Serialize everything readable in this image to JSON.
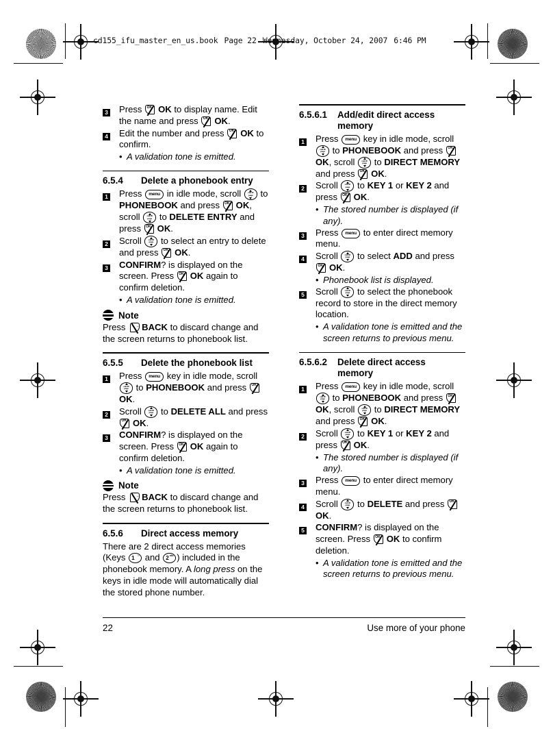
{
  "document": {
    "header_file": "cd155_ifu_master_en_us.book",
    "header_page": "Page 22",
    "header_day": "Wednesday, October 24, 2007",
    "header_time": "6:46 PM"
  },
  "icons": {
    "ok_key": "ok-softkey-icon",
    "back_key": "back-softkey-icon",
    "menu_key": "menu-key-icon",
    "scroll_key": "scroll-navigation-key-icon",
    "note": "note-icon",
    "key1": "keypad-1-icon",
    "key2": "keypad-2-icon"
  },
  "labels": {
    "ok": "OK",
    "back": "BACK",
    "menu": "menu",
    "scroll_mid_top": "call ID",
    "scroll_mid_bottom": "page",
    "key1_digit": "1",
    "key1_sub": "∞",
    "key2_digit": "2",
    "key2_sub": "abc",
    "note": "Note",
    "bullet_dot": "•"
  },
  "left_column": {
    "continued_steps": [
      {
        "num": "3",
        "parts": [
          {
            "t": "text",
            "v": "Press "
          },
          {
            "t": "key",
            "v": "ok"
          },
          {
            "t": "bold",
            "v": "OK"
          },
          {
            "t": "text",
            "v": " to display name. Edit the name and press "
          },
          {
            "t": "key",
            "v": "ok"
          },
          {
            "t": "bold",
            "v": "OK"
          },
          {
            "t": "text",
            "v": "."
          }
        ]
      },
      {
        "num": "4",
        "parts": [
          {
            "t": "text",
            "v": "Edit the number and press "
          },
          {
            "t": "key",
            "v": "ok"
          },
          {
            "t": "bold",
            "v": "OK"
          },
          {
            "t": "text",
            "v": " to confirm."
          }
        ],
        "bullets": [
          "A validation tone is emitted."
        ]
      }
    ],
    "sections": [
      {
        "num": "6.5.4",
        "title": "Delete a phonebook entry",
        "steps": [
          {
            "num": "1",
            "parts": [
              {
                "t": "text",
                "v": "Press "
              },
              {
                "t": "key",
                "v": "menu"
              },
              {
                "t": "text",
                "v": " in idle mode, scroll "
              },
              {
                "t": "key",
                "v": "scroll"
              },
              {
                "t": "text",
                "v": " to "
              },
              {
                "t": "bold",
                "v": "PHONEBOOK"
              },
              {
                "t": "text",
                "v": " and press "
              },
              {
                "t": "key",
                "v": "ok"
              },
              {
                "t": "bold",
                "v": "OK"
              },
              {
                "t": "text",
                "v": ", scroll "
              },
              {
                "t": "key",
                "v": "scroll"
              },
              {
                "t": "text",
                "v": " to "
              },
              {
                "t": "bold",
                "v": "DELETE ENTRY"
              },
              {
                "t": "text",
                "v": " and press "
              },
              {
                "t": "key",
                "v": "ok"
              },
              {
                "t": "bold",
                "v": "OK"
              },
              {
                "t": "text",
                "v": "."
              }
            ]
          },
          {
            "num": "2",
            "parts": [
              {
                "t": "text",
                "v": "Scroll "
              },
              {
                "t": "key",
                "v": "scroll"
              },
              {
                "t": "text",
                "v": " to select an entry to delete and press "
              },
              {
                "t": "key",
                "v": "ok"
              },
              {
                "t": "bold",
                "v": "OK"
              },
              {
                "t": "text",
                "v": "."
              }
            ]
          },
          {
            "num": "3",
            "parts": [
              {
                "t": "bold",
                "v": "CONFIRM"
              },
              {
                "t": "text",
                "v": "? is displayed on the screen. Press "
              },
              {
                "t": "key",
                "v": "ok"
              },
              {
                "t": "bold",
                "v": "OK"
              },
              {
                "t": "text",
                "v": " again to confirm deletion."
              }
            ],
            "bullets": [
              "A validation tone is emitted."
            ]
          }
        ],
        "note": {
          "title": "Note",
          "parts": [
            {
              "t": "text",
              "v": "Press "
            },
            {
              "t": "key",
              "v": "back"
            },
            {
              "t": "bold",
              "v": "BACK"
            },
            {
              "t": "text",
              "v": " to discard change and the screen returns to phonebook list."
            }
          ]
        }
      },
      {
        "num": "6.5.5",
        "title": "Delete the phonebook list",
        "steps": [
          {
            "num": "1",
            "parts": [
              {
                "t": "text",
                "v": "Press "
              },
              {
                "t": "key",
                "v": "menu"
              },
              {
                "t": "text",
                "v": " key in idle mode, scroll "
              },
              {
                "t": "key",
                "v": "scroll"
              },
              {
                "t": "text",
                "v": " to "
              },
              {
                "t": "bold",
                "v": "PHONEBOOK"
              },
              {
                "t": "text",
                "v": " and press "
              },
              {
                "t": "key",
                "v": "ok"
              },
              {
                "t": "bold",
                "v": "OK"
              },
              {
                "t": "text",
                "v": "."
              }
            ]
          },
          {
            "num": "2",
            "parts": [
              {
                "t": "text",
                "v": "Scroll "
              },
              {
                "t": "key",
                "v": "scroll"
              },
              {
                "t": "text",
                "v": " to "
              },
              {
                "t": "bold",
                "v": "DELETE ALL"
              },
              {
                "t": "text",
                "v": " and press "
              },
              {
                "t": "key",
                "v": "ok"
              },
              {
                "t": "bold",
                "v": "OK"
              },
              {
                "t": "text",
                "v": "."
              }
            ]
          },
          {
            "num": "3",
            "parts": [
              {
                "t": "bold",
                "v": "CONFIRM"
              },
              {
                "t": "text",
                "v": "? is displayed on the screen. Press "
              },
              {
                "t": "key",
                "v": "ok"
              },
              {
                "t": "bold",
                "v": "OK"
              },
              {
                "t": "text",
                "v": " again to confirm deletion."
              }
            ],
            "bullets": [
              "A validation tone is emitted."
            ]
          }
        ],
        "note": {
          "title": "Note",
          "parts": [
            {
              "t": "text",
              "v": "Press "
            },
            {
              "t": "key",
              "v": "back"
            },
            {
              "t": "bold",
              "v": "BACK"
            },
            {
              "t": "text",
              "v": " to discard change and the screen returns to phonebook list."
            }
          ]
        }
      },
      {
        "num": "6.5.6",
        "title": "Direct access memory",
        "paragraph": [
          {
            "t": "text",
            "v": "There are 2 direct access memories (Keys "
          },
          {
            "t": "key",
            "v": "key1"
          },
          {
            "t": "text",
            "v": " and "
          },
          {
            "t": "key",
            "v": "key2"
          },
          {
            "t": "text",
            "v": ") included in the phonebook memory. A "
          },
          {
            "t": "ital",
            "v": "long press"
          },
          {
            "t": "text",
            "v": " on the keys in idle mode will automatically dial the stored phone number."
          }
        ]
      }
    ]
  },
  "right_column": {
    "sections": [
      {
        "num": "6.5.6.1",
        "title_line1": "Add/edit direct access",
        "title_line2": "memory",
        "steps": [
          {
            "num": "1",
            "parts": [
              {
                "t": "text",
                "v": "Press "
              },
              {
                "t": "key",
                "v": "menu"
              },
              {
                "t": "text",
                "v": " key in idle mode, scroll "
              },
              {
                "t": "key",
                "v": "scroll"
              },
              {
                "t": "text",
                "v": " to "
              },
              {
                "t": "bold",
                "v": "PHONEBOOK"
              },
              {
                "t": "text",
                "v": " and press "
              },
              {
                "t": "key",
                "v": "ok"
              },
              {
                "t": "bold",
                "v": "OK"
              },
              {
                "t": "text",
                "v": ", scroll "
              },
              {
                "t": "key",
                "v": "scroll"
              },
              {
                "t": "text",
                "v": " to "
              },
              {
                "t": "bold",
                "v": "DIRECT MEMORY"
              },
              {
                "t": "text",
                "v": " and press "
              },
              {
                "t": "key",
                "v": "ok"
              },
              {
                "t": "bold",
                "v": "OK"
              },
              {
                "t": "text",
                "v": "."
              }
            ]
          },
          {
            "num": "2",
            "parts": [
              {
                "t": "text",
                "v": "Scroll "
              },
              {
                "t": "key",
                "v": "scroll"
              },
              {
                "t": "text",
                "v": " to "
              },
              {
                "t": "bold",
                "v": "KEY 1"
              },
              {
                "t": "text",
                "v": " or "
              },
              {
                "t": "bold",
                "v": "KEY 2"
              },
              {
                "t": "text",
                "v": " and press "
              },
              {
                "t": "key",
                "v": "ok"
              },
              {
                "t": "bold",
                "v": "OK"
              },
              {
                "t": "text",
                "v": "."
              }
            ],
            "bullets": [
              "The stored number is displayed (if any)."
            ]
          },
          {
            "num": "3",
            "parts": [
              {
                "t": "text",
                "v": "Press "
              },
              {
                "t": "key",
                "v": "menu"
              },
              {
                "t": "text",
                "v": " to enter direct memory menu."
              }
            ]
          },
          {
            "num": "4",
            "parts": [
              {
                "t": "text",
                "v": "Scroll "
              },
              {
                "t": "key",
                "v": "scroll"
              },
              {
                "t": "text",
                "v": " to select "
              },
              {
                "t": "bold",
                "v": "ADD"
              },
              {
                "t": "text",
                "v": " and press "
              },
              {
                "t": "key",
                "v": "ok"
              },
              {
                "t": "bold",
                "v": "OK"
              },
              {
                "t": "text",
                "v": "."
              }
            ],
            "bullets": [
              "Phonebook list is displayed."
            ]
          },
          {
            "num": "5",
            "parts": [
              {
                "t": "text",
                "v": "Scroll "
              },
              {
                "t": "key",
                "v": "scroll"
              },
              {
                "t": "text",
                "v": " to select the phonebook record to store in the direct memory location."
              }
            ],
            "bullets": [
              "A validation tone is emitted and the screen returns to previous menu."
            ]
          }
        ]
      },
      {
        "num": "6.5.6.2",
        "title_line1": "Delete direct access",
        "title_line2": "memory",
        "steps": [
          {
            "num": "1",
            "parts": [
              {
                "t": "text",
                "v": "Press "
              },
              {
                "t": "key",
                "v": "menu"
              },
              {
                "t": "text",
                "v": " key in idle mode, scroll "
              },
              {
                "t": "key",
                "v": "scroll"
              },
              {
                "t": "text",
                "v": " to "
              },
              {
                "t": "bold",
                "v": "PHONEBOOK"
              },
              {
                "t": "text",
                "v": " and press "
              },
              {
                "t": "key",
                "v": "ok"
              },
              {
                "t": "bold",
                "v": "OK"
              },
              {
                "t": "text",
                "v": ", scroll "
              },
              {
                "t": "key",
                "v": "scroll"
              },
              {
                "t": "text",
                "v": " to "
              },
              {
                "t": "bold",
                "v": "DIRECT MEMORY"
              },
              {
                "t": "text",
                "v": " and press "
              },
              {
                "t": "key",
                "v": "ok"
              },
              {
                "t": "bold",
                "v": "OK"
              },
              {
                "t": "text",
                "v": "."
              }
            ]
          },
          {
            "num": "2",
            "parts": [
              {
                "t": "text",
                "v": "Scroll "
              },
              {
                "t": "key",
                "v": "scroll"
              },
              {
                "t": "text",
                "v": " to "
              },
              {
                "t": "bold",
                "v": "KEY 1"
              },
              {
                "t": "text",
                "v": " or "
              },
              {
                "t": "bold",
                "v": "KEY 2"
              },
              {
                "t": "text",
                "v": " and press "
              },
              {
                "t": "key",
                "v": "ok"
              },
              {
                "t": "bold",
                "v": "OK"
              },
              {
                "t": "text",
                "v": "."
              }
            ],
            "bullets": [
              "The stored number is displayed (if any)."
            ]
          },
          {
            "num": "3",
            "parts": [
              {
                "t": "text",
                "v": "Press "
              },
              {
                "t": "key",
                "v": "menu"
              },
              {
                "t": "text",
                "v": " to enter direct memory menu."
              }
            ]
          },
          {
            "num": "4",
            "parts": [
              {
                "t": "text",
                "v": "Scroll "
              },
              {
                "t": "key",
                "v": "scroll"
              },
              {
                "t": "text",
                "v": " to "
              },
              {
                "t": "bold",
                "v": "DELETE"
              },
              {
                "t": "text",
                "v": " and press "
              },
              {
                "t": "key",
                "v": "ok"
              },
              {
                "t": "bold",
                "v": "OK"
              },
              {
                "t": "text",
                "v": "."
              }
            ]
          },
          {
            "num": "5",
            "parts": [
              {
                "t": "bold",
                "v": "CONFIRM"
              },
              {
                "t": "text",
                "v": "? is displayed on the screen. Press "
              },
              {
                "t": "key",
                "v": "ok"
              },
              {
                "t": "bold",
                "v": "OK"
              },
              {
                "t": "text",
                "v": " to confirm deletion."
              }
            ],
            "bullets": [
              "A validation tone is emitted and the screen returns to previous menu."
            ]
          }
        ]
      }
    ]
  },
  "footer": {
    "page_number": "22",
    "running_title": "Use more of your phone"
  }
}
